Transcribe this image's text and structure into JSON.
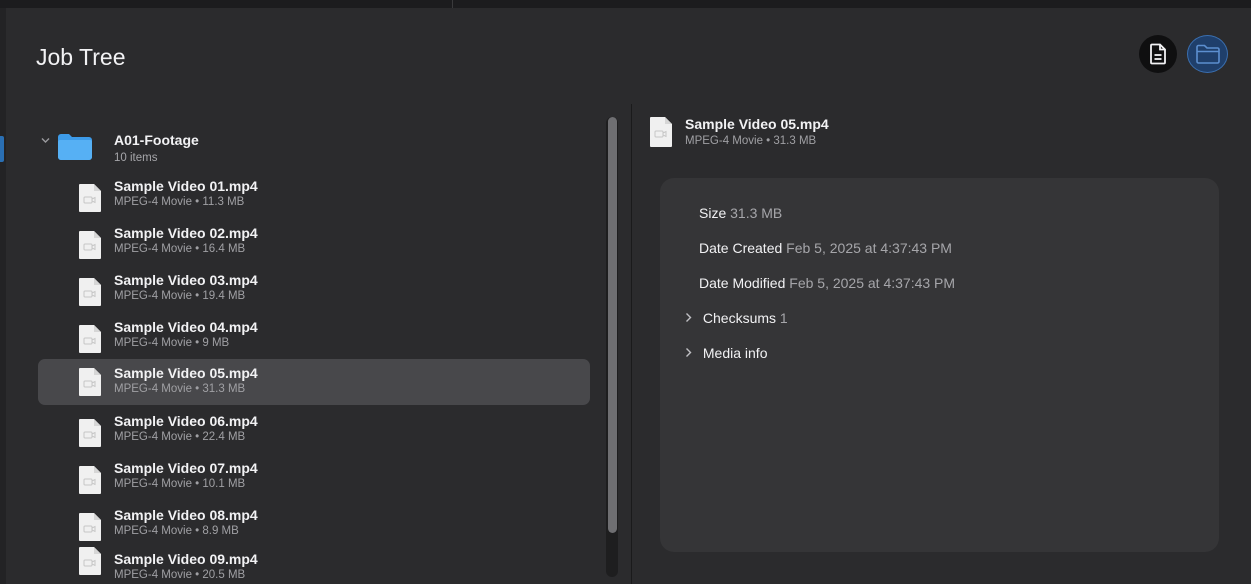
{
  "panel": {
    "title": "Job Tree"
  },
  "toolbar": {
    "document_icon": "document-icon",
    "folder_icon": "folder-icon",
    "active_accent": "#2a6fb3"
  },
  "tree": {
    "folder": {
      "name": "A01-Footage",
      "count_label": "10 items",
      "expanded": true
    },
    "files": [
      {
        "name": "Sample Video 01.mp4",
        "meta": "MPEG-4 Movie • 11.3 MB",
        "selected": false
      },
      {
        "name": "Sample Video 02.mp4",
        "meta": "MPEG-4 Movie • 16.4 MB",
        "selected": false
      },
      {
        "name": "Sample Video 03.mp4",
        "meta": "MPEG-4 Movie • 19.4 MB",
        "selected": false
      },
      {
        "name": "Sample Video 04.mp4",
        "meta": "MPEG-4 Movie • 9 MB",
        "selected": false
      },
      {
        "name": "Sample Video 05.mp4",
        "meta": "MPEG-4 Movie • 31.3 MB",
        "selected": true
      },
      {
        "name": "Sample Video 06.mp4",
        "meta": "MPEG-4 Movie • 22.4 MB",
        "selected": false
      },
      {
        "name": "Sample Video 07.mp4",
        "meta": "MPEG-4 Movie • 10.1 MB",
        "selected": false
      },
      {
        "name": "Sample Video 08.mp4",
        "meta": "MPEG-4 Movie • 8.9 MB",
        "selected": false
      },
      {
        "name": "Sample Video 09.mp4",
        "meta": "MPEG-4 Movie • 20.5 MB",
        "selected": false
      }
    ]
  },
  "detail": {
    "name": "Sample Video 05.mp4",
    "meta": "MPEG-4 Movie • 31.3 MB",
    "size_label": "Size",
    "size_value": "31.3 MB",
    "created_label": "Date Created",
    "created_value": "Feb 5, 2025 at 4:37:43 PM",
    "modified_label": "Date Modified",
    "modified_value": "Feb 5, 2025 at 4:37:43 PM",
    "checksums_label": "Checksums",
    "checksums_count": "1",
    "media_info_label": "Media info"
  }
}
